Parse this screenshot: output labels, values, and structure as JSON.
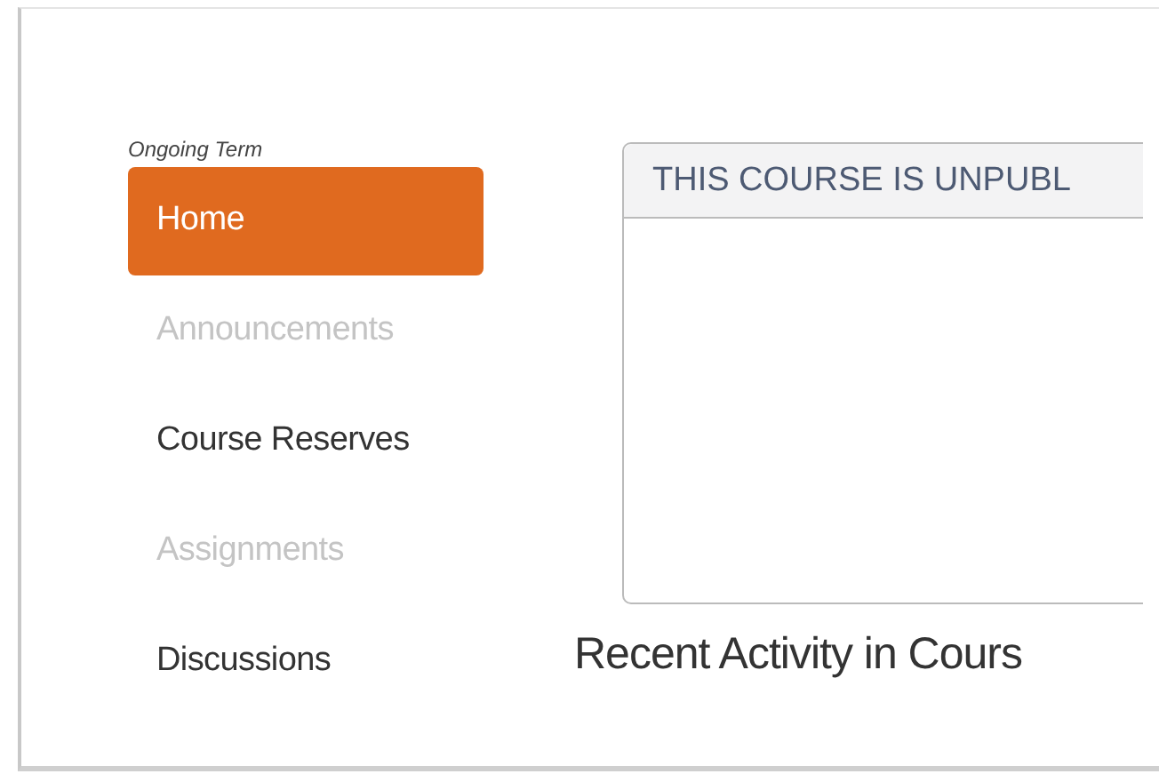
{
  "sidebar": {
    "term_label": "Ongoing Term",
    "items": [
      {
        "label": "Home",
        "selected": true,
        "disabled": false
      },
      {
        "label": "Announcements",
        "selected": false,
        "disabled": true
      },
      {
        "label": "Course Reserves",
        "selected": false,
        "disabled": false
      },
      {
        "label": "Assignments",
        "selected": false,
        "disabled": true
      },
      {
        "label": "Discussions",
        "selected": false,
        "disabled": false
      }
    ]
  },
  "notice": {
    "title": "THIS COURSE IS UNPUBL"
  },
  "recent_activity": {
    "heading": "Recent Activity in Cours"
  }
}
